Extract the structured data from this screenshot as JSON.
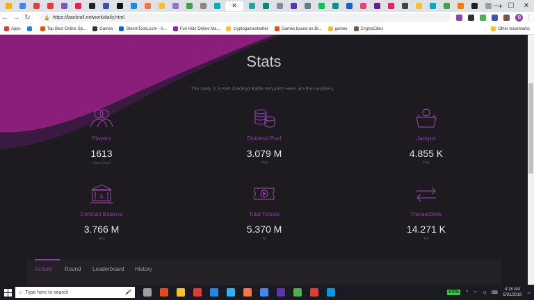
{
  "browser": {
    "url": "https://bankroll.network/daily.html",
    "tab_colors": [
      "#f4b400",
      "#4285f4",
      "#db4437",
      "#e53935",
      "#7e57c2",
      "#e91e63",
      "#222222",
      "#3f51b5",
      "#111111",
      "#1e88e5",
      "#ff7043",
      "#fbc02d",
      "#9575cd",
      "#43a047",
      "#888888",
      "#00acc1",
      "#e53935",
      "#26a69a",
      "#00897b",
      "#78909c",
      "#5e35b1",
      "#607d8b",
      "#00c853",
      "#009688",
      "#1565c0",
      "#ec407a",
      "#6a1b9a",
      "#e91e63",
      "#37474f",
      "#fbc02d",
      "#00acc1",
      "#43a047",
      "#f57c00",
      "#212121",
      "#9e9e9e"
    ],
    "ext_colors": [
      "#8e44ad",
      "#333333",
      "#4caf50",
      "#3f51b5",
      "#795548"
    ],
    "avatar_initial": "B"
  },
  "bookmarks": {
    "items": [
      {
        "label": "Apps",
        "color": "#e53935"
      },
      {
        "label": "",
        "color": "#1e88e5"
      },
      {
        "label": "Top Best Online Sp...",
        "color": "#e65100"
      },
      {
        "label": "Games",
        "color": "#333333"
      },
      {
        "label": "SteemTools.com - A...",
        "color": "#1565c0"
      },
      {
        "label": "Fun Kids Online Ma...",
        "color": "#8e24aa"
      },
      {
        "label": "cryptogamestwitter",
        "color": "#fbc02d"
      },
      {
        "label": "Games based on Bl...",
        "color": "#e64a19"
      },
      {
        "label": "games",
        "color": "#fbc02d"
      },
      {
        "label": "CryptoCities",
        "color": "#795548"
      }
    ],
    "other": "Other bookmarks"
  },
  "page": {
    "title": "Stats",
    "subtitle": "The Daily is a PvP dividend Battle Royale!!! Here are the numbers...",
    "stats": [
      {
        "label": "Players",
        "value": "1613",
        "unit": "User Count",
        "icon": "players-icon"
      },
      {
        "label": "Dividend Pool",
        "value": "3.079 M",
        "unit": "TRX",
        "icon": "coins-icon"
      },
      {
        "label": "Jackpot",
        "value": "4.855 K",
        "unit": "TRX",
        "icon": "jackpot-icon"
      },
      {
        "label": "Contract Balance",
        "value": "3.766 M",
        "unit": "TRX",
        "icon": "bank-icon"
      },
      {
        "label": "Total Tickets",
        "value": "5.370 M",
        "unit": "Tix",
        "icon": "ticket-icon"
      },
      {
        "label": "Transactions",
        "value": "14.271 K",
        "unit": "Txs",
        "icon": "transactions-icon"
      }
    ],
    "tabs": [
      "Activity",
      "Round",
      "Leaderboard",
      "History"
    ],
    "active_tab": "Activity",
    "accent": "#8e3fa2"
  },
  "taskbar": {
    "search_placeholder": "Type here to search",
    "icon_colors": [
      "#9e9e9e",
      "#e64a19",
      "#fbc02d",
      "#e53935",
      "#1e88e5",
      "#29b6f6",
      "#ff7043",
      "#4285f4",
      "#5e35b1",
      "#4caf50",
      "#e53935",
      "#039be5"
    ],
    "battery": "100%",
    "time": "4:18 AM",
    "date": "5/31/2019"
  }
}
